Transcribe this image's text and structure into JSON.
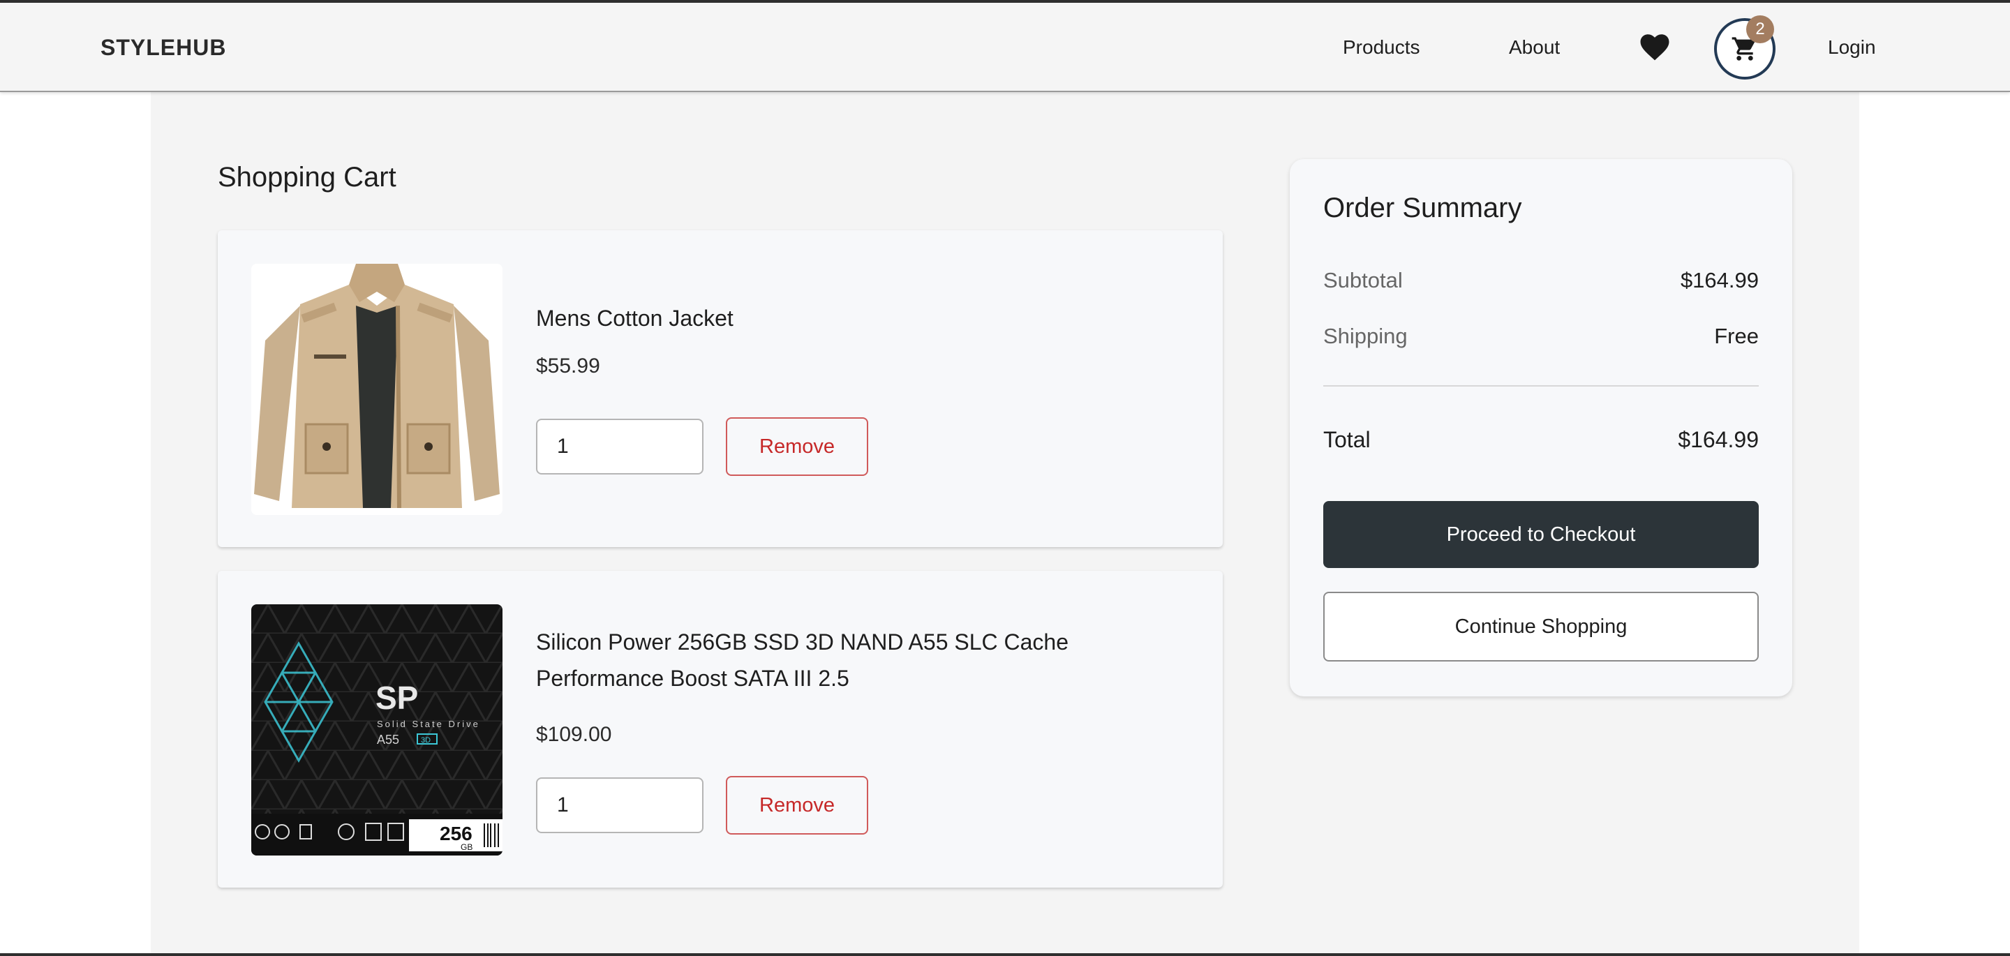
{
  "header": {
    "brand": "STYLEHUB",
    "nav": {
      "products": "Products",
      "about": "About",
      "login": "Login"
    },
    "cart_count": "2",
    "icons": {
      "wishlist": "heart-icon",
      "cart": "cart-icon"
    }
  },
  "cart": {
    "title": "Shopping Cart",
    "items": [
      {
        "name": "Mens Cotton Jacket",
        "price": "$55.99",
        "quantity": "1",
        "remove_label": "Remove"
      },
      {
        "name": "Silicon Power 256GB SSD 3D NAND A55 SLC Cache Performance Boost SATA III 2.5",
        "price": "$109.00",
        "quantity": "1",
        "remove_label": "Remove"
      }
    ]
  },
  "summary": {
    "title": "Order Summary",
    "subtotal_label": "Subtotal",
    "subtotal_value": "$164.99",
    "shipping_label": "Shipping",
    "shipping_value": "Free",
    "total_label": "Total",
    "total_value": "$164.99",
    "checkout_label": "Proceed to Checkout",
    "continue_label": "Continue Shopping"
  },
  "product_image_text": {
    "ssd_logo": "SP",
    "ssd_subtitle": "Solid State Drive",
    "ssd_model": "A55",
    "ssd_badge": "3D",
    "ssd_capacity": "256",
    "ssd_unit": "GB"
  },
  "colors": {
    "accent_dark": "#2c3439",
    "remove_red": "#c62828",
    "badge_brown": "#a37d60",
    "cart_ring": "#233a55"
  }
}
